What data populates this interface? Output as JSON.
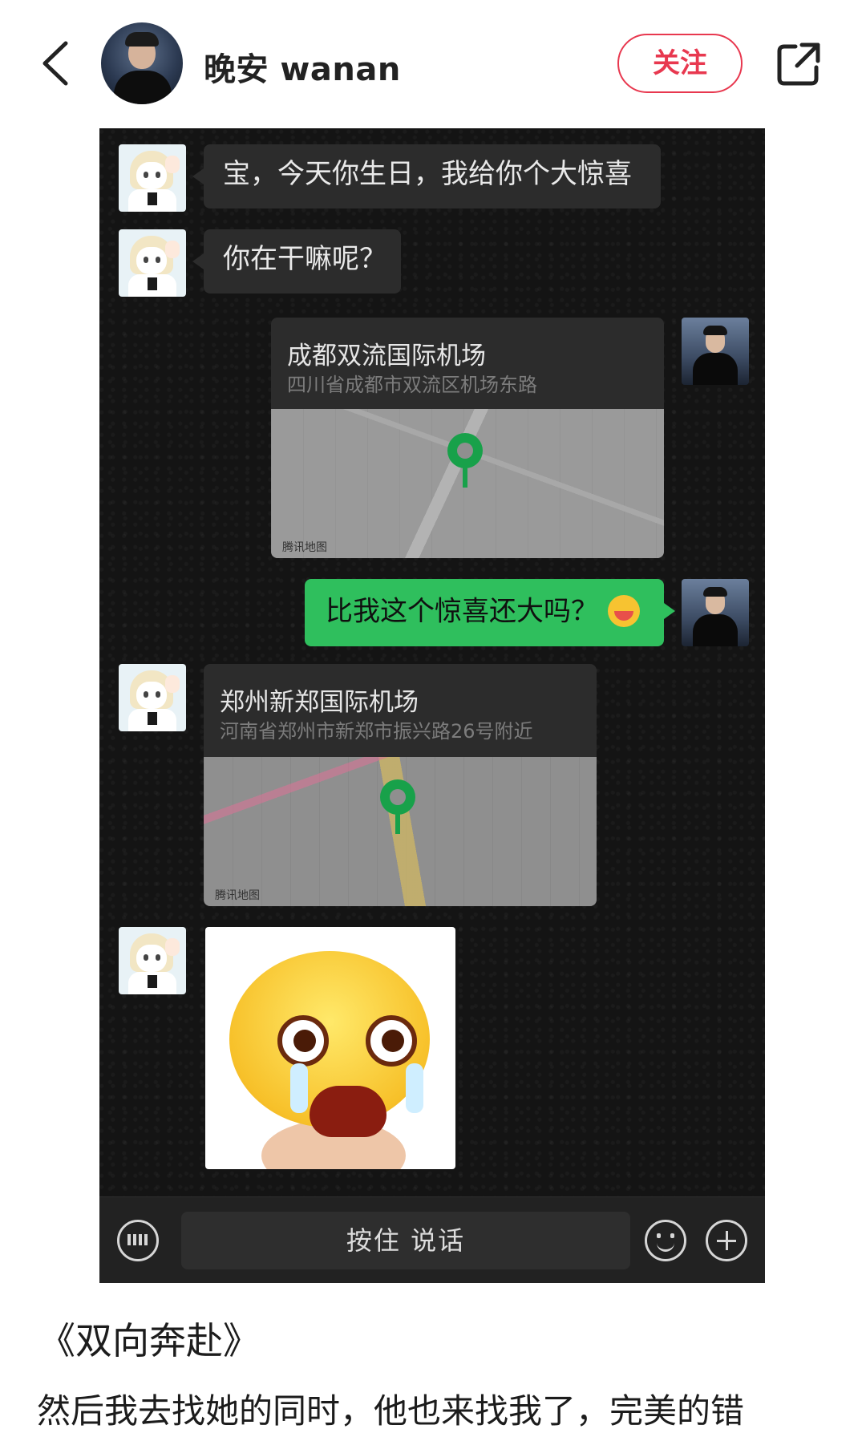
{
  "header": {
    "username": "晚安 wanan",
    "follow_label": "关注"
  },
  "chat": {
    "messages": [
      {
        "side": "left",
        "type": "text",
        "text": "宝，今天你生日，我给你个大惊喜"
      },
      {
        "side": "left",
        "type": "text",
        "text": "你在干嘛呢？"
      },
      {
        "side": "right",
        "type": "location",
        "title": "成都双流国际机场",
        "address": "四川省成都市双流区机场东路",
        "map_source": "腾讯地图"
      },
      {
        "side": "right",
        "type": "text",
        "text": "比我这个惊喜还大吗？",
        "emoji": "mask-face-emoji"
      },
      {
        "side": "left",
        "type": "location",
        "title": "郑州新郑国际机场",
        "address": "河南省郑州市新郑市振兴路26号附近",
        "map_source": "腾讯地图"
      },
      {
        "side": "left",
        "type": "sticker",
        "sticker": "crying-face-sticker"
      }
    ],
    "input_bar": {
      "hold_to_talk_label": "按住 说话",
      "icons": [
        "keyboard-icon",
        "smile-icon",
        "plus-icon"
      ]
    }
  },
  "post": {
    "title": "《双向奔赴》",
    "body": "然后我去找她的同时，他也来找我了，完美的错"
  },
  "colors": {
    "accent_red": "#e8384f",
    "chat_bg": "#141414",
    "bubble_dark": "#2c2c2c",
    "bubble_green": "#2fbf5d",
    "pin_green": "#18a14a"
  }
}
